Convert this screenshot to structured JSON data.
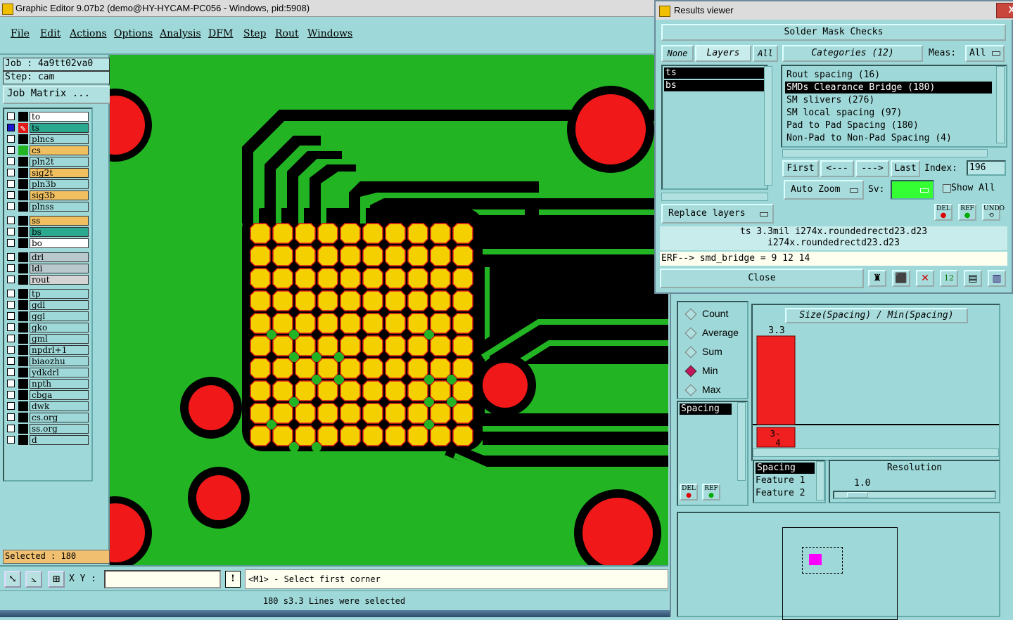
{
  "main_window": {
    "title": "Graphic Editor 9.07b2 (demo@HY-HYCAM-PC056 - Windows, pid:5908)",
    "menu": [
      "File",
      "Edit",
      "Actions",
      "Options",
      "Analysis",
      "DFM",
      "Step",
      "Rout",
      "Windows"
    ]
  },
  "left_panel": {
    "job": "Job : 4a9tt02va0",
    "step": "Step: cam",
    "job_matrix": "Job Matrix ...",
    "selected": "Selected : 180",
    "layers": [
      {
        "name": "to",
        "color": "#ffffff",
        "swatch": "#000000",
        "mark": "⬋"
      },
      {
        "name": "ts",
        "color": "#2aa890",
        "swatch": "#e01818",
        "mark": "⊞",
        "active": true
      },
      {
        "name": "plncs",
        "color": "#9fd8d8",
        "swatch": "#000000"
      },
      {
        "name": "cs",
        "color": "#f0c060",
        "swatch": "#22b422"
      },
      {
        "name": "pln2t",
        "color": "#9fd8d8",
        "swatch": "#000000"
      },
      {
        "name": "sig2t",
        "color": "#f0c060",
        "swatch": "#000000"
      },
      {
        "name": "pln3b",
        "color": "#9fd8d8",
        "swatch": "#000000"
      },
      {
        "name": "sig3b",
        "color": "#f0c060",
        "swatch": "#000000"
      },
      {
        "name": "plnss",
        "color": "#9fd8d8",
        "swatch": "#000000"
      },
      {
        "name": "ss",
        "color": "#f0c060",
        "swatch": "#000000"
      },
      {
        "name": "bs",
        "color": "#2aa890",
        "swatch": "#000000"
      },
      {
        "name": "bo",
        "color": "#ffffff",
        "swatch": "#000000"
      },
      {
        "name": "drl",
        "color": "#b8c8cc",
        "swatch": "#000000"
      },
      {
        "name": "ldi",
        "color": "#b8c8cc",
        "swatch": "#000000"
      },
      {
        "name": "rout",
        "color": "#d4d4d4",
        "swatch": "#000000"
      },
      {
        "name": "tp",
        "color": "#9fd8d8",
        "swatch": "#000000"
      },
      {
        "name": "gdl",
        "color": "#9fd8d8",
        "swatch": "#000000",
        "mark": "⬋"
      },
      {
        "name": "ggl",
        "color": "#9fd8d8",
        "swatch": "#000000"
      },
      {
        "name": "gko",
        "color": "#9fd8d8",
        "swatch": "#000000"
      },
      {
        "name": "gml",
        "color": "#9fd8d8",
        "swatch": "#000000",
        "mark": "⬋"
      },
      {
        "name": "npdrl+1",
        "color": "#9fd8d8",
        "swatch": "#000000"
      },
      {
        "name": "biaozhu",
        "color": "#9fd8d8",
        "swatch": "#000000"
      },
      {
        "name": "ydkdrl",
        "color": "#9fd8d8",
        "swatch": "#000000"
      },
      {
        "name": "npth",
        "color": "#9fd8d8",
        "swatch": "#000000"
      },
      {
        "name": "cbga",
        "color": "#9fd8d8",
        "swatch": "#000000"
      },
      {
        "name": "dwk",
        "color": "#9fd8d8",
        "swatch": "#000000"
      },
      {
        "name": "cs.org",
        "color": "#9fd8d8",
        "swatch": "#000000"
      },
      {
        "name": "ss.org",
        "color": "#9fd8d8",
        "swatch": "#000000"
      },
      {
        "name": "d",
        "color": "#9fd8d8",
        "swatch": "#000000"
      }
    ]
  },
  "command_bar": {
    "xy_label": "X Y :",
    "xy_value": "",
    "warn": "!",
    "prompt": "<M1> - Select first corner",
    "status": "180 s3.3 Lines were selected"
  },
  "results_viewer": {
    "title": "Results viewer",
    "close_x": "X",
    "header": "Solder Mask Checks",
    "layer_filter": [
      "None",
      "Layers",
      "All"
    ],
    "layers": [
      "ts",
      "bs"
    ],
    "categories_label": "Categories (12)",
    "meas_label": "Meas:",
    "meas_value": "All",
    "categories": [
      "Rout spacing (16)",
      "SMDs Clearance Bridge (180)",
      "SM slivers (276)",
      "SM local spacing (97)",
      "Pad to Pad Spacing (180)",
      "Non-Pad to Non-Pad Spacing (4)"
    ],
    "selected_category": "SMDs Clearance Bridge (180)",
    "nav": [
      "First",
      "<---",
      "--->",
      "Last"
    ],
    "index_label": "Index:",
    "index_value": "196",
    "auto_zoom": "Auto Zoom",
    "sv_label": "Sv:",
    "show_all": "Show All",
    "replace_layers": "Replace layers",
    "icon_del": "DEL",
    "icon_ref": "REF",
    "icon_undo": "UNDO",
    "info_line1": "ts 3.3mil  i274x.roundedrectd23.d23",
    "info_line2": "i274x.roundedrectd23.d23",
    "erf_line": "ERF--> smd_bridge = 9 12 14",
    "close_label": "Close"
  },
  "stats_panel": {
    "modes": [
      "Count",
      "Average",
      "Sum",
      "Min",
      "Max"
    ],
    "selected_mode": "Min",
    "chart_title": "Size(Spacing) / Min(Spacing)",
    "attribute_list": [
      "Spacing"
    ],
    "feature_list": [
      "Spacing",
      "Feature 1",
      "Feature 2"
    ],
    "resolution_label": "Resolution",
    "resolution_value": "1.0",
    "del_label": "DEL",
    "ref_label": "REF"
  },
  "chart_data": {
    "type": "bar",
    "title": "Size(Spacing) / Min(Spacing)",
    "categories": [
      "3-4"
    ],
    "values": [
      3.3
    ],
    "value_label": "3.3",
    "category_label_lines": [
      "3-",
      "4"
    ],
    "bar_color": "#f02020"
  },
  "preview": {
    "marker_color": "#ff00ff"
  }
}
